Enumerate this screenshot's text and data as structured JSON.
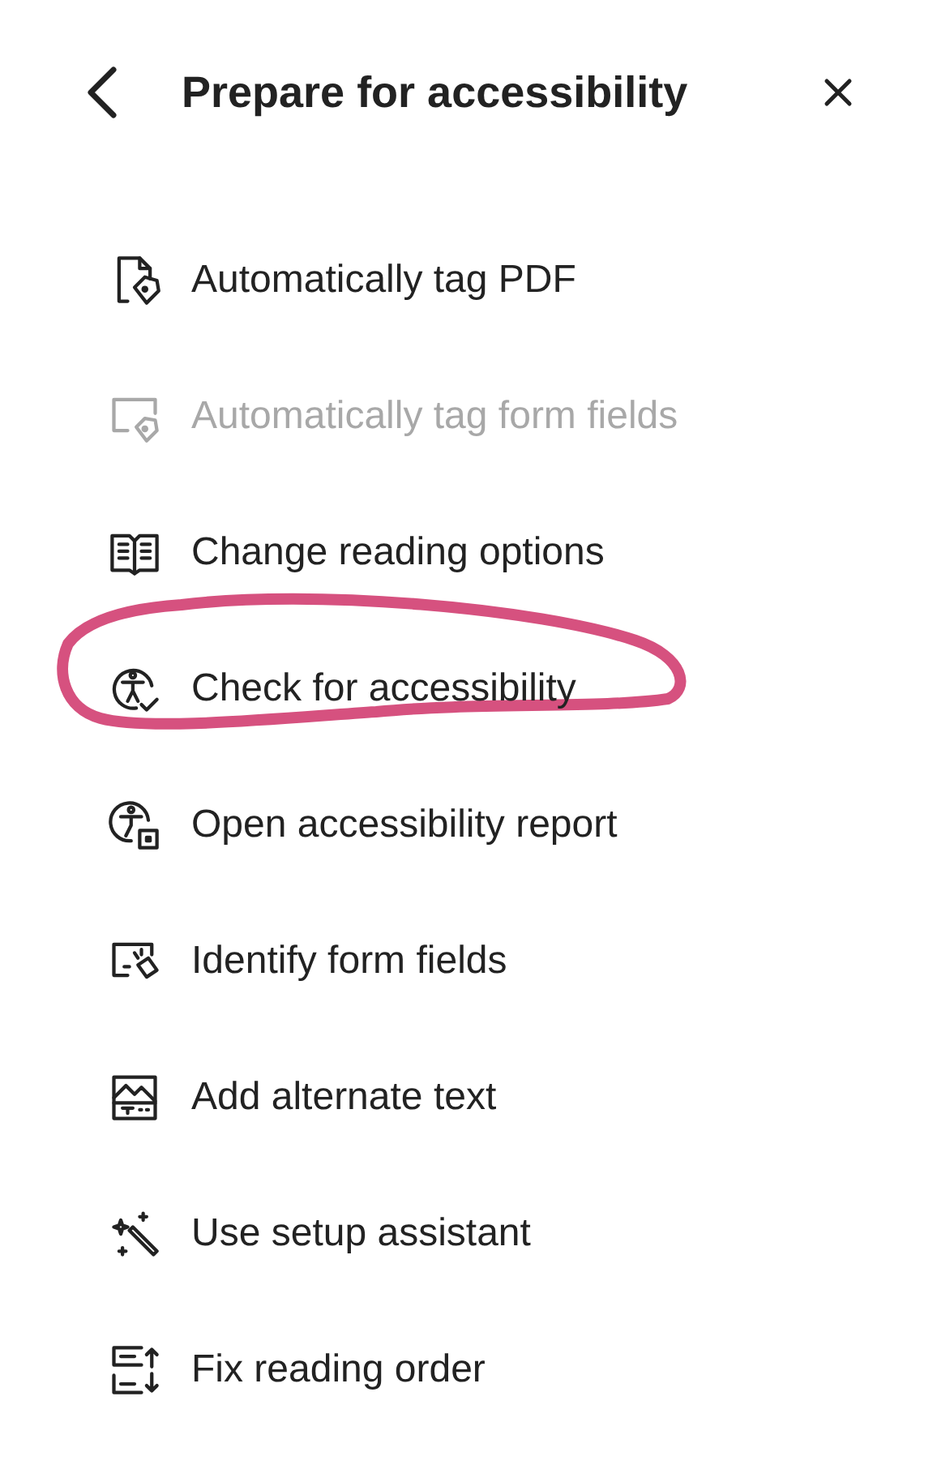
{
  "header": {
    "title": "Prepare for accessibility"
  },
  "items": [
    {
      "label": "Automatically tag PDF",
      "disabled": false,
      "circled": false
    },
    {
      "label": "Automatically tag form fields",
      "disabled": true,
      "circled": false
    },
    {
      "label": "Change reading options",
      "disabled": false,
      "circled": false
    },
    {
      "label": "Check for accessibility",
      "disabled": false,
      "circled": true
    },
    {
      "label": "Open accessibility report",
      "disabled": false,
      "circled": false
    },
    {
      "label": "Identify form fields",
      "disabled": false,
      "circled": false
    },
    {
      "label": "Add alternate text",
      "disabled": false,
      "circled": false
    },
    {
      "label": "Use setup assistant",
      "disabled": false,
      "circled": false
    },
    {
      "label": "Fix reading order",
      "disabled": false,
      "circled": false
    }
  ]
}
